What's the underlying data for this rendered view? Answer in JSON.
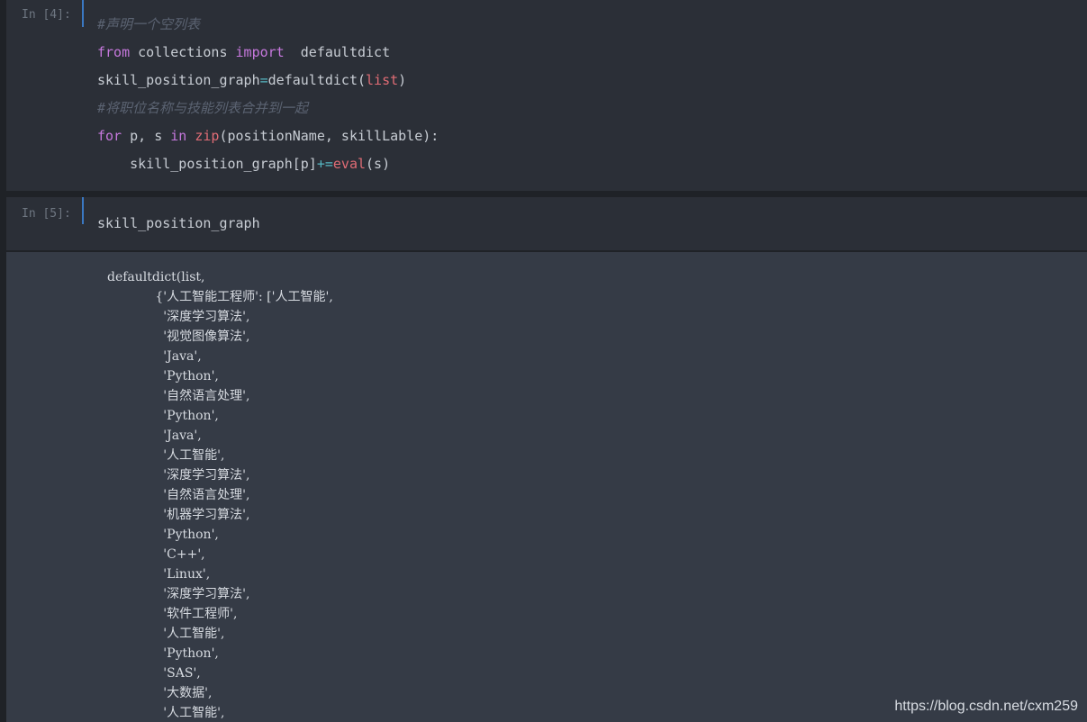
{
  "cells": [
    {
      "prompt": "In [4]:",
      "lines": [
        [
          {
            "t": "#声明一个空列表",
            "c": "cm"
          }
        ],
        [
          {
            "t": "from",
            "c": "kw"
          },
          {
            "t": " collections ",
            "c": ""
          },
          {
            "t": "import",
            "c": "kw"
          },
          {
            "t": "  defaultdict",
            "c": ""
          }
        ],
        [
          {
            "t": "skill_position_graph",
            "c": ""
          },
          {
            "t": "=",
            "c": "op"
          },
          {
            "t": "defaultdict(",
            "c": ""
          },
          {
            "t": "list",
            "c": "bi"
          },
          {
            "t": ")",
            "c": ""
          }
        ],
        [
          {
            "t": "#将职位名称与技能列表合并到一起",
            "c": "cm"
          }
        ],
        [
          {
            "t": "for",
            "c": "kw"
          },
          {
            "t": " p, s ",
            "c": ""
          },
          {
            "t": "in",
            "c": "kw"
          },
          {
            "t": " ",
            "c": ""
          },
          {
            "t": "zip",
            "c": "bi"
          },
          {
            "t": "(positionName, skillLable):",
            "c": ""
          }
        ],
        [
          {
            "t": "    skill_position_graph[p]",
            "c": ""
          },
          {
            "t": "+=",
            "c": "op"
          },
          {
            "t": "eval",
            "c": "bi"
          },
          {
            "t": "(s)",
            "c": ""
          }
        ]
      ]
    },
    {
      "prompt": "In [5]:",
      "lines": [
        [
          {
            "t": "skill_position_graph",
            "c": ""
          }
        ]
      ]
    }
  ],
  "output_lines": [
    "defaultdict(list,",
    "            {'人工智能工程师': ['人工智能',",
    "              '深度学习算法',",
    "              '视觉图像算法',",
    "              'Java',",
    "              'Python',",
    "              '自然语言处理',",
    "              'Python',",
    "              'Java',",
    "              '人工智能',",
    "              '深度学习算法',",
    "              '自然语言处理',",
    "              '机器学习算法',",
    "              'Python',",
    "              'C++',",
    "              'Linux',",
    "              '深度学习算法',",
    "              '软件工程师',",
    "              '人工智能',",
    "              'Python',",
    "              'SAS',",
    "              '大数据',",
    "              '人工智能',"
  ],
  "watermark": "https://blog.csdn.net/cxm259"
}
